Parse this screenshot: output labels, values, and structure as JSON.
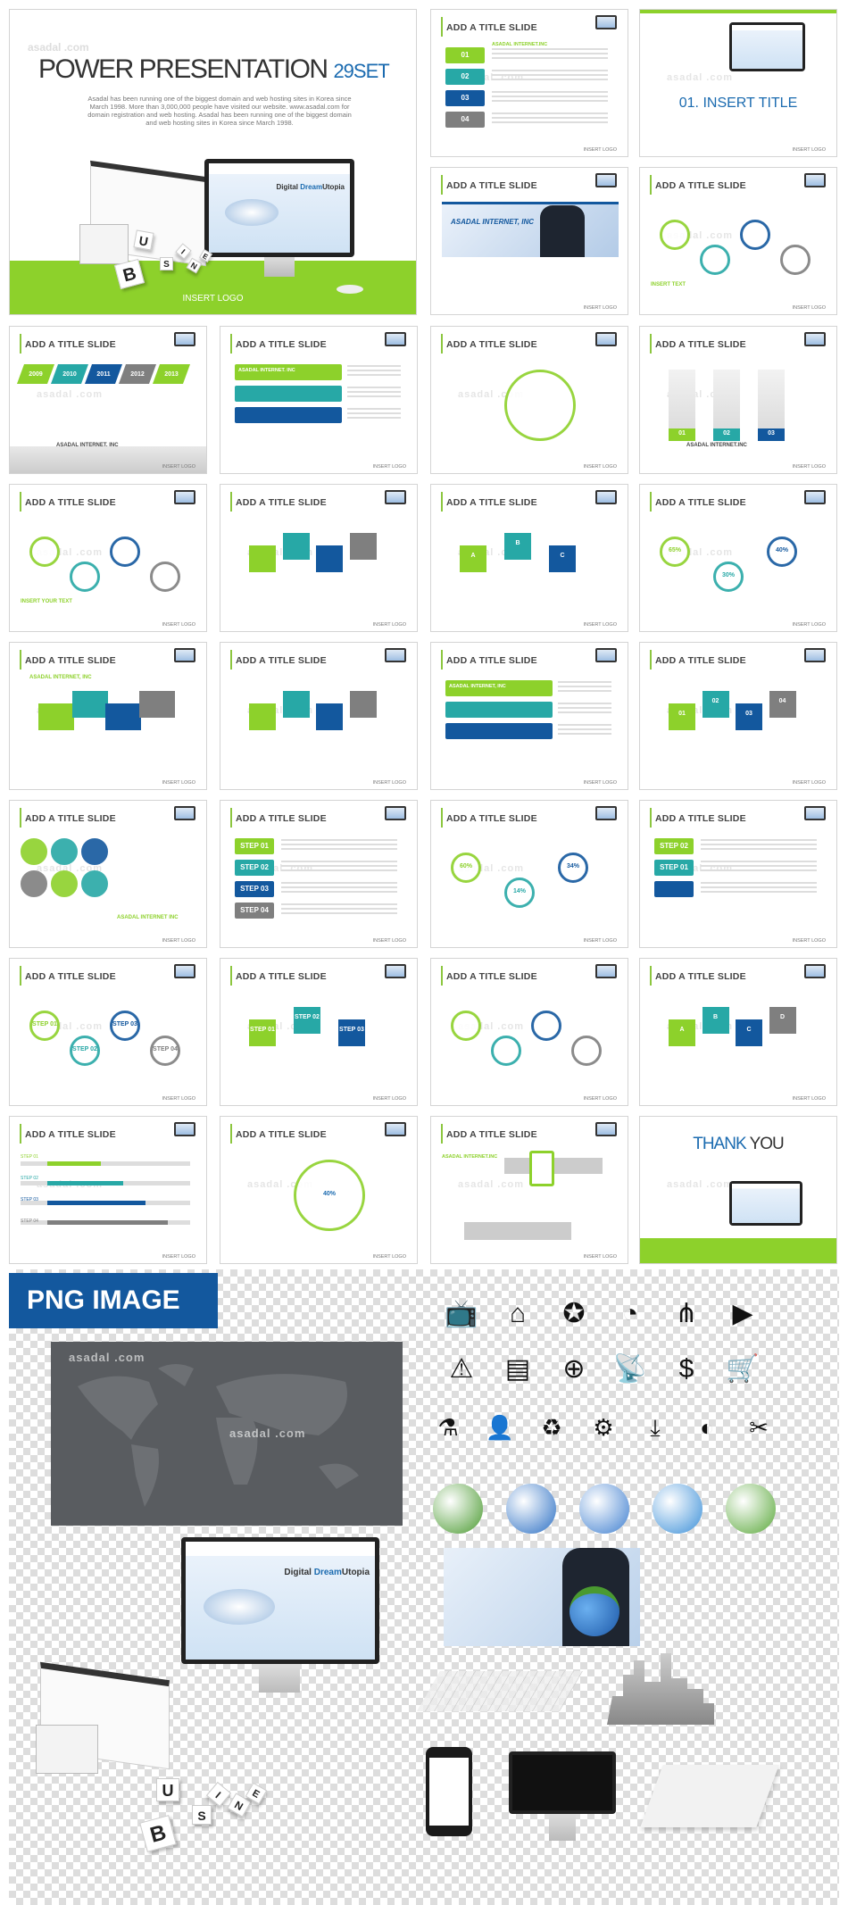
{
  "watermark": "asadal .com",
  "cover": {
    "title": "POWER PRESENTATION",
    "set": "29SET",
    "paragraph": "Asadal has been running one of the biggest domain and web hosting sites in Korea since March 1998. More than 3,000,000 people have visited our website. www.asadal.com for domain registration and web hosting. Asadal has been running one of the biggest domain and web hosting sites in Korea since March 1998.",
    "screen_headline_a": "Digital ",
    "screen_headline_b": "Dream",
    "screen_headline_c": "Utopia",
    "logo": "INSERT LOGO",
    "cube_letters": [
      "B",
      "U",
      "S",
      "I",
      "N",
      "E"
    ]
  },
  "slides": [
    {
      "title": "ADD A TITLE SLIDE",
      "variant": "steps",
      "labels": [
        "01",
        "02",
        "03",
        "04"
      ],
      "text": "ASADAL INTERNET.INC"
    },
    {
      "title": "01. INSERT TITLE",
      "variant": "section"
    },
    {
      "title": "ADD A TITLE SLIDE",
      "variant": "photo",
      "text": "ASADAL INTERNET, INC"
    },
    {
      "title": "ADD A TITLE SLIDE",
      "variant": "cloud",
      "text": "INSERT TEXT"
    },
    {
      "title": "ADD A TITLE SLIDE",
      "variant": "timeline",
      "labels": [
        "2009",
        "2010",
        "2011",
        "2012",
        "2013"
      ],
      "text": "ASADAL INTERNET. INC"
    },
    {
      "title": "ADD A TITLE SLIDE",
      "variant": "arrows",
      "text": "ASADAL INTERNET. INC"
    },
    {
      "title": "ADD A TITLE SLIDE",
      "variant": "bulb"
    },
    {
      "title": "ADD A TITLE SLIDE",
      "variant": "bars3d",
      "labels": [
        "01",
        "02",
        "03"
      ],
      "text": "ASADAL INTERNET.INC"
    },
    {
      "title": "ADD A TITLE SLIDE",
      "variant": "network",
      "text": "INSERT YOUR TEXT"
    },
    {
      "title": "ADD A TITLE SLIDE",
      "variant": "tablet"
    },
    {
      "title": "ADD A TITLE SLIDE",
      "variant": "cubes",
      "labels": [
        "A",
        "B",
        "C"
      ]
    },
    {
      "title": "ADD A TITLE SLIDE",
      "variant": "rings",
      "labels": [
        "65%",
        "30%",
        "40%"
      ]
    },
    {
      "title": "ADD A TITLE SLIDE",
      "variant": "window",
      "text": "ASADAL INTERNET, INC"
    },
    {
      "title": "ADD A TITLE SLIDE",
      "variant": "cart"
    },
    {
      "title": "ADD A TITLE SLIDE",
      "variant": "table",
      "text": "ASADAL INTERNET, INC"
    },
    {
      "title": "ADD A TITLE SLIDE",
      "variant": "hexagons",
      "labels": [
        "01",
        "02",
        "03",
        "04"
      ]
    },
    {
      "title": "ADD A TITLE SLIDE",
      "variant": "circles",
      "text": "ASADAL INTERNET INC"
    },
    {
      "title": "ADD A TITLE SLIDE",
      "variant": "steplist",
      "labels": [
        "STEP 01",
        "STEP 02",
        "STEP 03",
        "STEP 04"
      ]
    },
    {
      "title": "ADD A TITLE SLIDE",
      "variant": "donut",
      "labels": [
        "60%",
        "14%",
        "34%"
      ]
    },
    {
      "title": "ADD A TITLE SLIDE",
      "variant": "folder",
      "labels": [
        "STEP 02",
        "STEP 01"
      ]
    },
    {
      "title": "ADD A TITLE SLIDE",
      "variant": "drops",
      "labels": [
        "STEP 01",
        "STEP 02",
        "STEP 03",
        "STEP 04"
      ]
    },
    {
      "title": "ADD A TITLE SLIDE",
      "variant": "cubesteps",
      "labels": [
        "STEP 01",
        "STEP 02",
        "STEP 03"
      ]
    },
    {
      "title": "ADD A TITLE SLIDE",
      "variant": "circlerow"
    },
    {
      "title": "ADD A TITLE SLIDE",
      "variant": "isoblocks",
      "labels": [
        "A",
        "B",
        "C",
        "D"
      ]
    },
    {
      "title": "ADD A TITLE SLIDE",
      "variant": "sliders",
      "labels": [
        "STEP 01",
        "STEP 02",
        "STEP 03",
        "STEP 04"
      ]
    },
    {
      "title": "ADD A TITLE SLIDE",
      "variant": "gauge",
      "labels": [
        "40%"
      ]
    },
    {
      "title": "ADD A TITLE SLIDE",
      "variant": "hand",
      "text": "ASADAL INTERNET.INC"
    },
    {
      "title": "THANK YOU",
      "variant": "thankyou",
      "title_a": "THANK ",
      "title_b": "YOU"
    }
  ],
  "slide_footer": "INSERT LOGO",
  "png_section": {
    "label": "PNG IMAGE",
    "icons": [
      "tv-icon",
      "home-icon",
      "award-icon",
      "rss-icon",
      "share-icon",
      "video-icon",
      "warning-icon",
      "battery-icon",
      "globe-icon",
      "satellite-icon",
      "money-bag-icon",
      "cart-icon",
      "flask-add-icon",
      "user-add-icon",
      "recycle-bin-icon",
      "gears-icon",
      "download-icon",
      "mouse-icon",
      "tools-icon"
    ],
    "screen_headline_a": "Digital ",
    "screen_headline_b": "Dream",
    "screen_headline_c": "Utopia",
    "cube_letters": [
      "B",
      "U",
      "S",
      "I",
      "N",
      "E"
    ]
  },
  "colors": {
    "green": "#8dd12b",
    "blue": "#13589e",
    "teal": "#27a8a6",
    "gray": "#7f7f7f"
  }
}
